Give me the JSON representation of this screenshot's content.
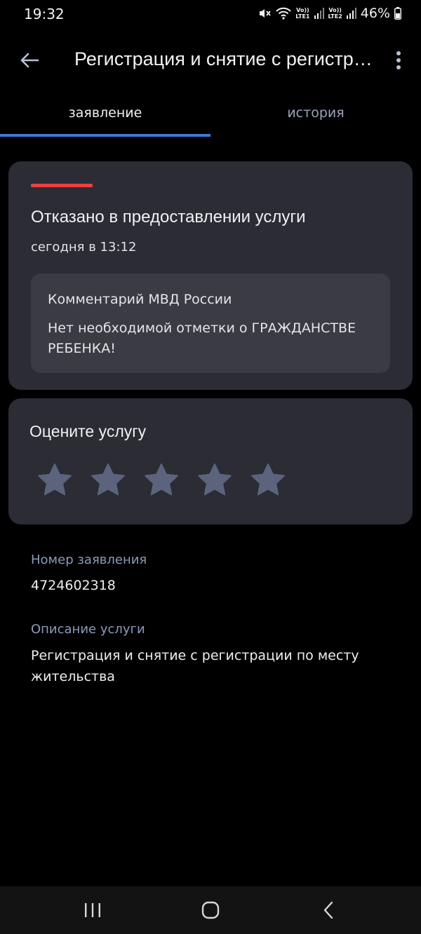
{
  "status_bar": {
    "time": "19:32",
    "sim1": [
      "Vo))",
      "LTE1"
    ],
    "sim2": [
      "Vo))",
      "LTE2"
    ],
    "battery": "46%"
  },
  "app_bar": {
    "title": "Регистрация и снятие с регистрации по месту жительства"
  },
  "tabs": [
    {
      "label": "заявление",
      "active": true
    },
    {
      "label": "история",
      "active": false
    }
  ],
  "status_card": {
    "title": "Отказано в предоставлении услуги",
    "time": "сегодня в 13:12",
    "status_color": "#ee3f3f",
    "comment": {
      "title": "Комментарий МВД России",
      "text": "Нет необходимой отметки о ГРАЖДАНСТВЕ РЕБЕНКА!"
    }
  },
  "rating": {
    "title": "Оцените услугу",
    "max_stars": 5,
    "selected": 0,
    "star_color": "#5b647c"
  },
  "details": {
    "application_number_label": "Номер заявления",
    "application_number": "4724602318",
    "service_description_label": "Описание услуги",
    "service_description": "Регистрация и снятие с регистрации по месту жительства"
  },
  "colors": {
    "accent": "#3d7bd6",
    "card_bg": "#2b2c34",
    "comment_bg": "#3a3b43",
    "label": "#8d9ab8"
  }
}
